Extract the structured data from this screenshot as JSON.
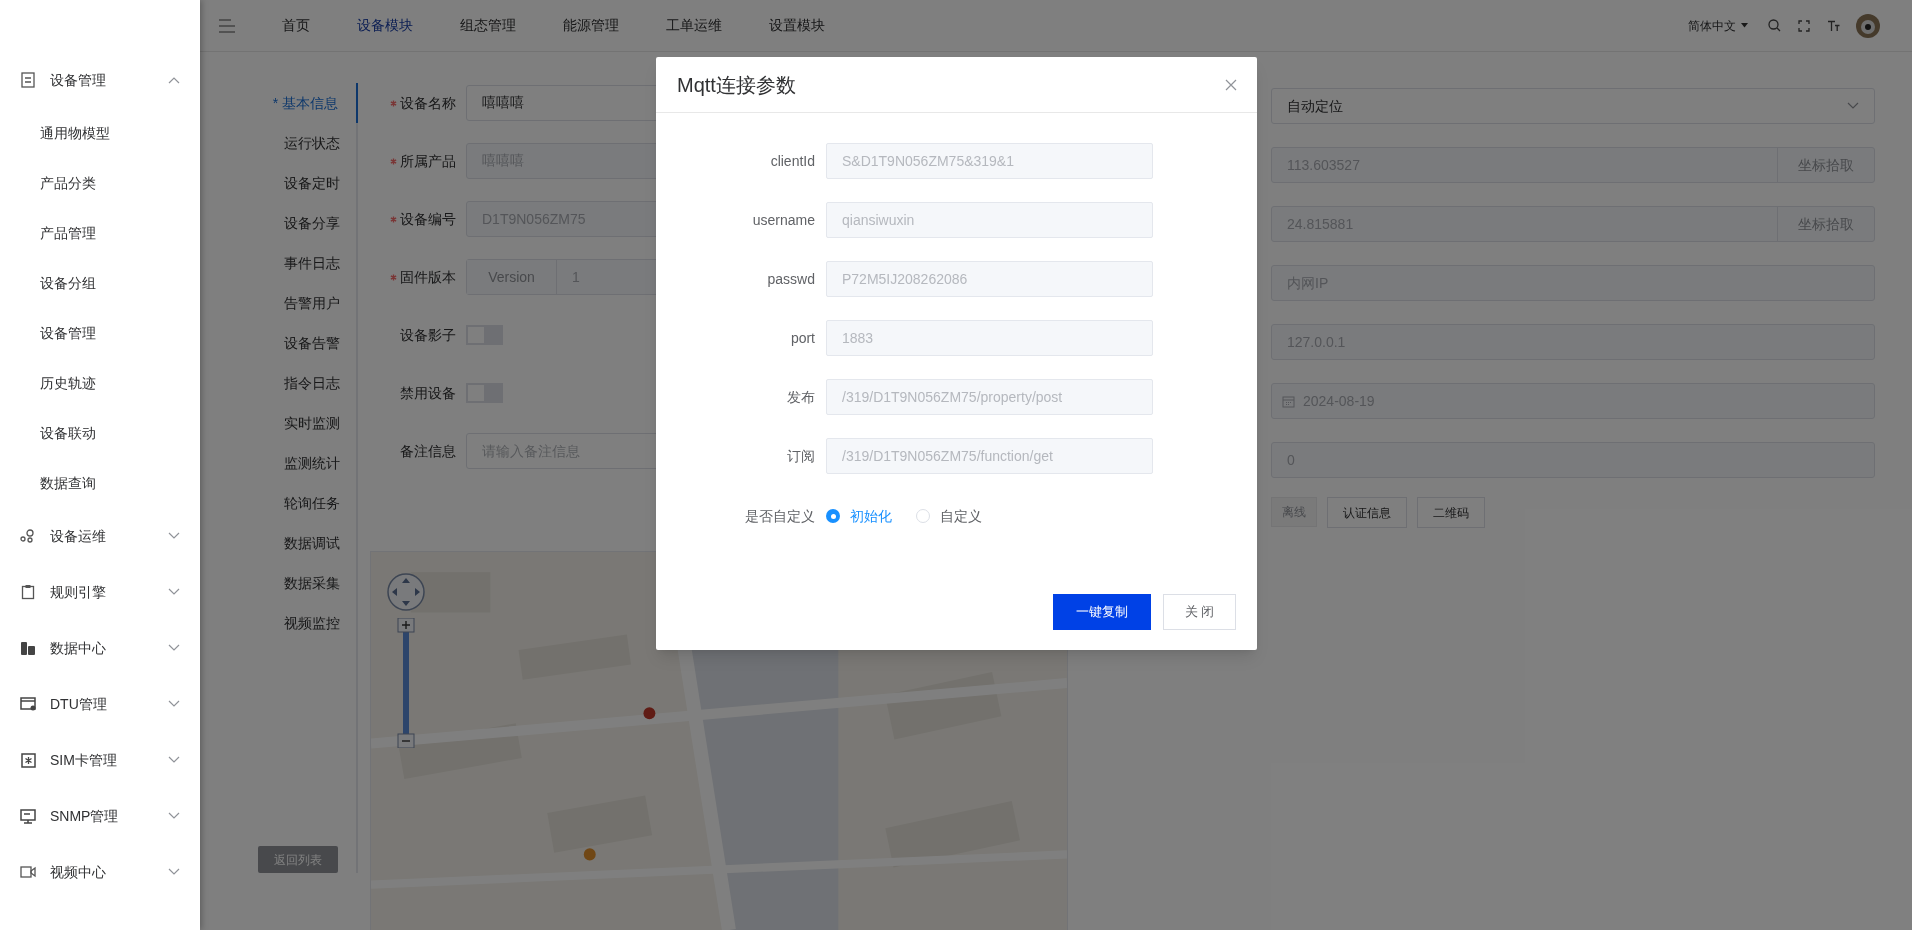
{
  "topbar": {
    "nav": [
      {
        "label": "首页",
        "selected": false
      },
      {
        "label": "设备模块",
        "selected": true
      },
      {
        "label": "组态管理",
        "selected": false
      },
      {
        "label": "能源管理",
        "selected": false
      },
      {
        "label": "工单运维",
        "selected": false
      },
      {
        "label": "设置模块",
        "selected": false
      }
    ],
    "language": "简体中文"
  },
  "sidebar": {
    "items": [
      {
        "label": "设备管理",
        "expanded": true,
        "children": [
          {
            "label": "通用物模型"
          },
          {
            "label": "产品分类"
          },
          {
            "label": "产品管理"
          },
          {
            "label": "设备分组"
          },
          {
            "label": "设备管理"
          },
          {
            "label": "历史轨迹"
          },
          {
            "label": "设备联动"
          },
          {
            "label": "数据查询"
          }
        ]
      },
      {
        "label": "设备运维",
        "expanded": false
      },
      {
        "label": "规则引擎",
        "expanded": false
      },
      {
        "label": "数据中心",
        "expanded": false
      },
      {
        "label": "DTU管理",
        "expanded": false
      },
      {
        "label": "SIM卡管理",
        "expanded": false
      },
      {
        "label": "SNMP管理",
        "expanded": false
      },
      {
        "label": "视频中心",
        "expanded": false
      }
    ]
  },
  "sections": [
    {
      "label": "* 基本信息",
      "selected": true
    },
    {
      "label": "运行状态",
      "selected": false
    },
    {
      "label": "设备定时",
      "selected": false
    },
    {
      "label": "设备分享",
      "selected": false
    },
    {
      "label": "事件日志",
      "selected": false
    },
    {
      "label": "告警用户",
      "selected": false
    },
    {
      "label": "设备告警",
      "selected": false
    },
    {
      "label": "指令日志",
      "selected": false
    },
    {
      "label": "实时监测",
      "selected": false
    },
    {
      "label": "监测统计",
      "selected": false
    },
    {
      "label": "轮询任务",
      "selected": false
    },
    {
      "label": "数据调试",
      "selected": false
    },
    {
      "label": "数据采集",
      "selected": false
    },
    {
      "label": "视频监控",
      "selected": false
    }
  ],
  "back_button": "返回列表",
  "form": {
    "fields": [
      {
        "kind": "input",
        "label": "设备名称",
        "required": true,
        "value": "嘻嘻嘻",
        "disabled": false
      },
      {
        "kind": "input",
        "label": "所属产品",
        "required": true,
        "value": "嘻嘻嘻",
        "disabled": true
      },
      {
        "kind": "input",
        "label": "设备编号",
        "required": true,
        "value": "D1T9N056ZM75",
        "disabled": true
      },
      {
        "kind": "version",
        "label": "固件版本",
        "required": true,
        "prefix": "Version",
        "value": "1",
        "disabled": true
      },
      {
        "kind": "switch",
        "label": "设备影子",
        "required": false,
        "on": false
      },
      {
        "kind": "switch",
        "label": "禁用设备",
        "required": false,
        "on": false
      },
      {
        "kind": "input",
        "label": "备注信息",
        "required": false,
        "placeholder": "请输入备注信息"
      }
    ]
  },
  "right_form": {
    "fields": [
      {
        "kind": "select",
        "value": "自动定位"
      },
      {
        "kind": "pick",
        "value": "113.603527",
        "button": "坐标拾取"
      },
      {
        "kind": "pick",
        "value": "24.815881",
        "button": "坐标拾取"
      },
      {
        "kind": "input",
        "value": "内网IP"
      },
      {
        "kind": "input",
        "value": "127.0.0.1"
      },
      {
        "kind": "date",
        "value": "2024-08-19"
      },
      {
        "kind": "input",
        "value": "0"
      }
    ],
    "actions": [
      {
        "kind": "tag",
        "label": "离线"
      },
      {
        "kind": "button",
        "label": "认证信息"
      },
      {
        "kind": "button",
        "label": "二维码"
      }
    ]
  },
  "dialog": {
    "title": "Mqtt连接参数",
    "fields": [
      {
        "label": "clientId",
        "value": "S&D1T9N056ZM75&319&1"
      },
      {
        "label": "username",
        "value": "qiansiwuxin"
      },
      {
        "label": "passwd",
        "value": "P72M5IJ208262086"
      },
      {
        "label": "port",
        "value": "1883"
      },
      {
        "label": "发布",
        "value": "/319/D1T9N056ZM75/property/post"
      },
      {
        "label": "订阅",
        "value": "/319/D1T9N056ZM75/function/get"
      }
    ],
    "custom": {
      "label": "是否自定义",
      "options": [
        {
          "label": "初始化",
          "selected": true
        },
        {
          "label": "自定义",
          "selected": false
        }
      ]
    },
    "buttons": [
      {
        "kind": "primary",
        "label": "一键复制"
      },
      {
        "kind": "default",
        "label": "关 闭"
      }
    ]
  }
}
